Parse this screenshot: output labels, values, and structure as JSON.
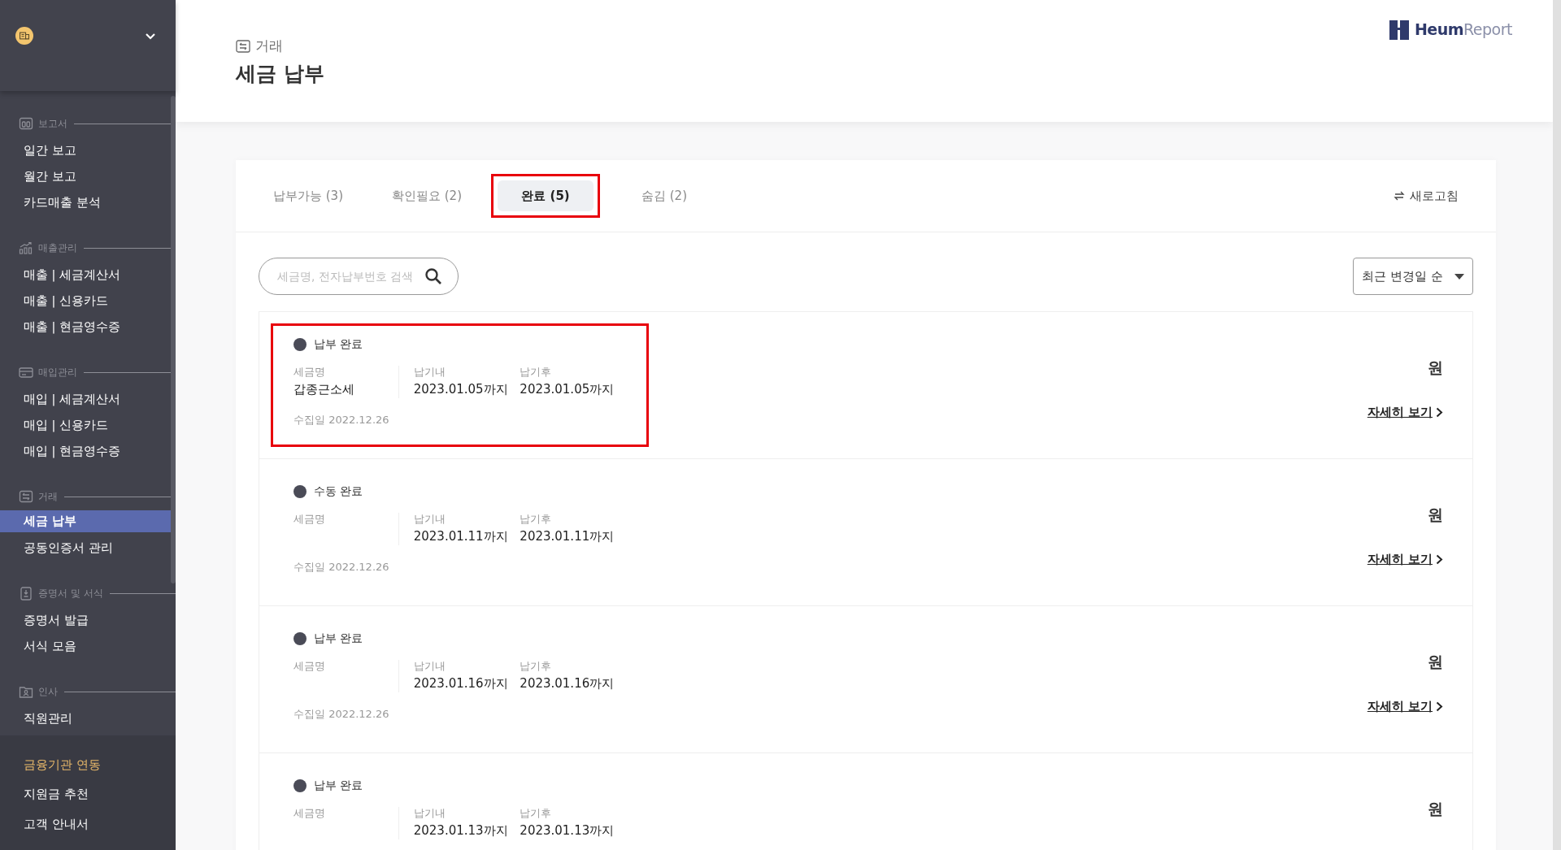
{
  "sidebar": {
    "sections": [
      {
        "header": "보고서",
        "items": [
          {
            "label": "일간 보고",
            "selected": false
          },
          {
            "label": "월간 보고",
            "selected": false
          },
          {
            "label": "카드매출 분석",
            "selected": false
          }
        ]
      },
      {
        "header": "매출관리",
        "items": [
          {
            "label": "매출 | 세금계산서",
            "selected": false
          },
          {
            "label": "매출 | 신용카드",
            "selected": false
          },
          {
            "label": "매출 | 현금영수증",
            "selected": false
          }
        ]
      },
      {
        "header": "매입관리",
        "items": [
          {
            "label": "매입 | 세금계산서",
            "selected": false
          },
          {
            "label": "매입 | 신용카드",
            "selected": false
          },
          {
            "label": "매입 | 현금영수증",
            "selected": false
          }
        ]
      },
      {
        "header": "거래",
        "items": [
          {
            "label": "세금 납부",
            "selected": true
          },
          {
            "label": "공동인증서 관리",
            "selected": false
          }
        ]
      },
      {
        "header": "증명서 및 서식",
        "items": [
          {
            "label": "증명서 발급",
            "selected": false
          },
          {
            "label": "서식 모음",
            "selected": false
          }
        ]
      },
      {
        "header": "인사",
        "items": [
          {
            "label": "직원관리",
            "selected": false
          }
        ]
      }
    ],
    "bottom_links": [
      {
        "label": "금융기관 연동",
        "kind": "accent"
      },
      {
        "label": "지원금 추천",
        "kind": "plain"
      },
      {
        "label": "고객 안내서",
        "kind": "plain"
      }
    ]
  },
  "header": {
    "breadcrumb": "거래",
    "title": "세금 납부",
    "logo": {
      "bold_part": "Heum",
      "light_part": "Report"
    }
  },
  "tabs": [
    {
      "label": "납부가능 (3)",
      "selected": false,
      "highlighted": false
    },
    {
      "label": "확인필요 (2)",
      "selected": false,
      "highlighted": false
    },
    {
      "label": "완료 (5)",
      "selected": true,
      "highlighted": true
    },
    {
      "label": "숨김 (2)",
      "selected": false,
      "highlighted": false
    }
  ],
  "refresh_button": "새로고침",
  "search": {
    "placeholder": "세금명, 전자납부번호 검색"
  },
  "sort_dropdown": "최근 변경일 순",
  "items": [
    {
      "status": "납부 완료",
      "highlighted": true,
      "fields": [
        {
          "label": "세금명",
          "value": "갑종근소세"
        },
        {
          "label": "납기내",
          "value": "2023.01.05까지"
        },
        {
          "label": "납기후",
          "value": "2023.01.05까지"
        }
      ],
      "collected": "수집일 2022.12.26",
      "amount": "원",
      "link": "자세히 보기"
    },
    {
      "status": "수동 완료",
      "highlighted": false,
      "fields": [
        {
          "label": "세금명"
        },
        {
          "label": "납기내",
          "value": "2023.01.11까지"
        },
        {
          "label": "납기후",
          "value": "2023.01.11까지"
        }
      ],
      "collected": "수집일 2022.12.26",
      "amount": "원",
      "link": "자세히 보기"
    },
    {
      "status": "납부 완료",
      "highlighted": false,
      "fields": [
        {
          "label": "세금명"
        },
        {
          "label": "납기내",
          "value": "2023.01.16까지"
        },
        {
          "label": "납기후",
          "value": "2023.01.16까지"
        }
      ],
      "collected": "수집일 2022.12.26",
      "amount": "원",
      "link": "자세히 보기"
    },
    {
      "status": "납부 완료",
      "highlighted": false,
      "fields": [
        {
          "label": "세금명"
        },
        {
          "label": "납기내",
          "value": "2023.01.13까지"
        },
        {
          "label": "납기후",
          "value": "2023.01.13까지"
        }
      ],
      "amount": "원"
    }
  ]
}
